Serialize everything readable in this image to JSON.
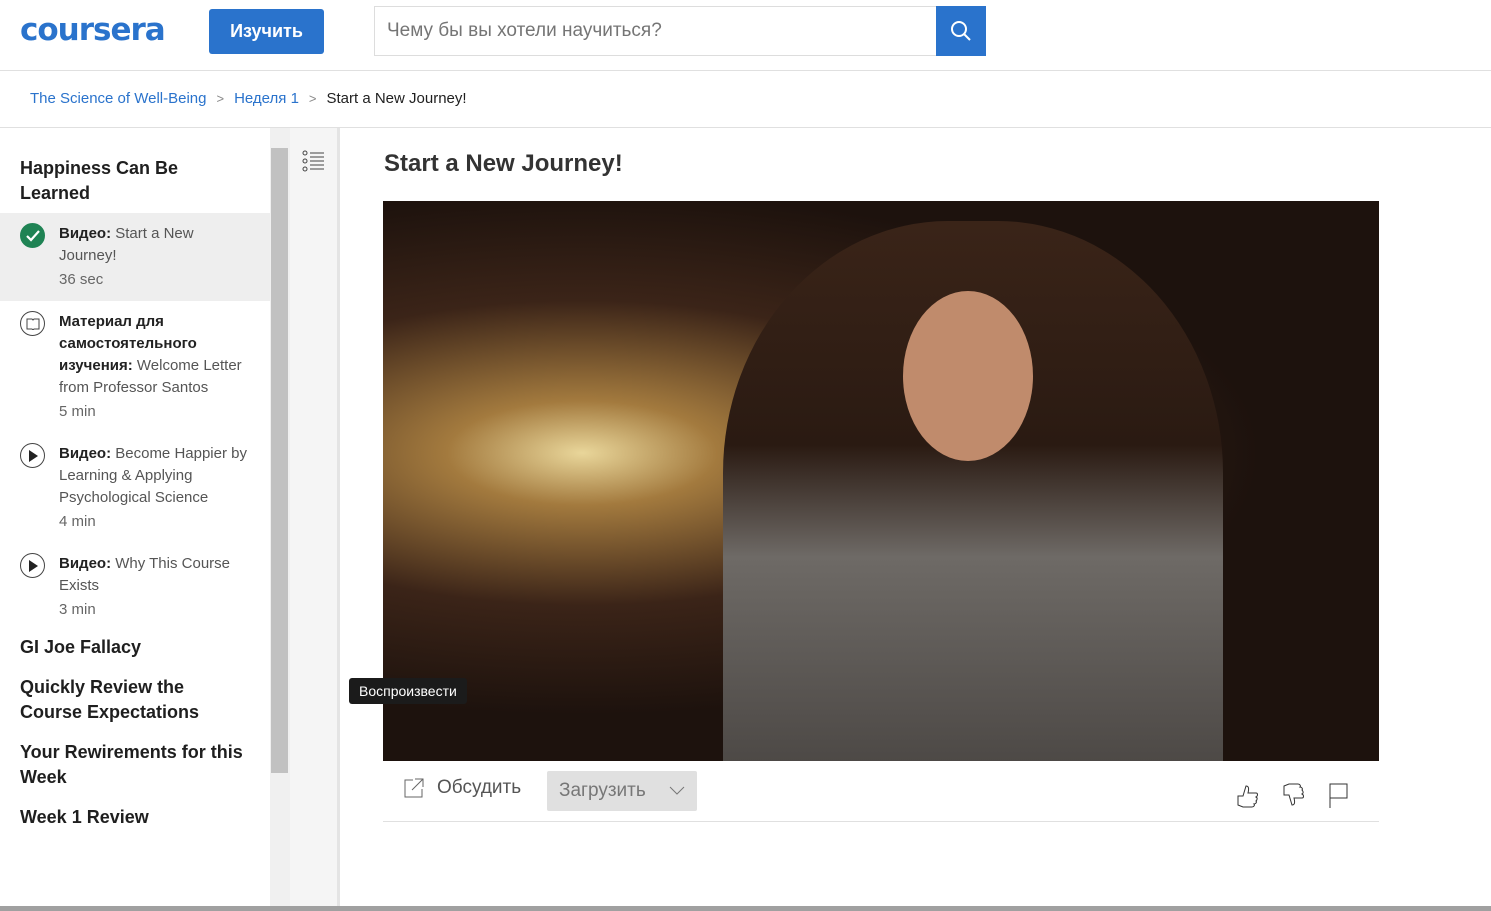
{
  "header": {
    "logo": "coursera",
    "explore_label": "Изучить",
    "search_placeholder": "Чему бы вы хотели научиться?"
  },
  "breadcrumb": {
    "course": "The Science of Well-Being",
    "week": "Неделя 1",
    "current": "Start a New Journey!"
  },
  "sidebar": {
    "section1": "Happiness Can Be Learned",
    "items": [
      {
        "type": "Видео:",
        "title": "Start a New Journey!",
        "duration": "36 sec"
      },
      {
        "type": "Материал для самостоятельного изучения:",
        "title": "Welcome Letter from Professor Santos",
        "duration": "5 min"
      },
      {
        "type": "Видео:",
        "title": "Become Happier by Learning & Applying Psychological Science",
        "duration": "4 min"
      },
      {
        "type": "Видео:",
        "title": "Why This Course Exists",
        "duration": "3 min"
      }
    ],
    "sections": [
      "GI Joe Fallacy",
      "Quickly Review the Course Expectations",
      "Your Rewirements for this Week",
      "Week 1 Review"
    ]
  },
  "main": {
    "title": "Start a New Journey!",
    "tooltip": "Воспроизвести",
    "discuss_label": "Обсудить",
    "download_label": "Загрузить"
  }
}
